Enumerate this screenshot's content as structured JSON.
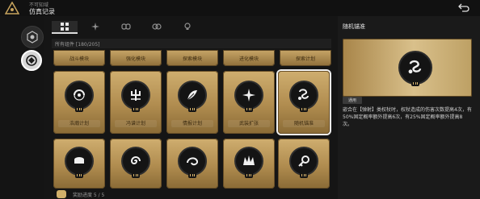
{
  "header": {
    "subtitle": "不可知域",
    "title": "仿真记录",
    "icons": {
      "logo": "triangle-emblem-icon",
      "back": "back-return-icon"
    }
  },
  "sidebar": {
    "items": [
      {
        "icon": "hexagon-badge-icon",
        "selected": false
      },
      {
        "icon": "circle-emblem-icon",
        "selected": true
      }
    ]
  },
  "tabs": [
    {
      "icon": "grid-icon",
      "active": true
    },
    {
      "icon": "sparkle-icon",
      "active": false
    },
    {
      "icon": "link-icon",
      "active": false
    },
    {
      "icon": "loop-icon",
      "active": false
    },
    {
      "icon": "bulb-icon",
      "active": false
    }
  ],
  "grid": {
    "header": "所有组件 [180/205]",
    "partial_row": [
      "战斗模块",
      "强化模块",
      "探索模块",
      "进化模块",
      "探索计划"
    ],
    "row1": [
      {
        "label": "浩瀚计划",
        "icon": "galaxy-icon"
      },
      {
        "label": "冯谱计划",
        "icon": "trident-icon"
      },
      {
        "label": "情报计划",
        "icon": "leaf-blade-icon"
      },
      {
        "label": "武装扩张",
        "icon": "spark-burst-icon"
      },
      {
        "label": "随机锚准",
        "icon": "dragon-swirl-icon",
        "selected": true
      }
    ],
    "row2": [
      {
        "icon": "sushi-icon"
      },
      {
        "icon": "spiral-icon"
      },
      {
        "icon": "vortex-icon"
      },
      {
        "icon": "crown-spikes-icon"
      },
      {
        "icon": "key-ring-icon"
      }
    ]
  },
  "bottom": {
    "text": "奖励进度 5 / 5"
  },
  "panel": {
    "title": "随机锚准",
    "tag": "通用",
    "description": "嵌合在【弹射】类权杖时，权杖造成的伤害次数提高4次，有50%固定概率额外提高6次，有25%固定概率额外提高8次。",
    "icon": "dragon-swirl-icon"
  },
  "colors": {
    "gold_light": "#cfae6f",
    "gold_dark": "#8a6b36",
    "bg": "#151515"
  }
}
